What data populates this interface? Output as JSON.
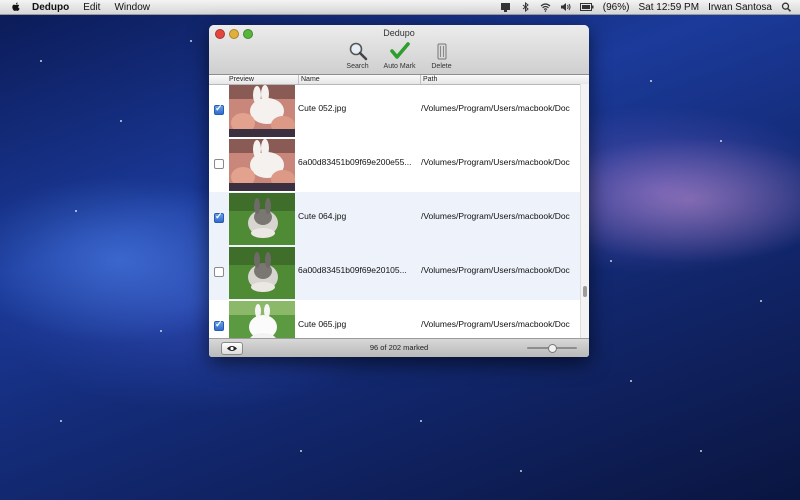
{
  "menubar": {
    "app_name": "Dedupo",
    "menus": [
      "Edit",
      "Window"
    ],
    "battery": "(96%)",
    "clock": "Sat 12:59 PM",
    "user": "Irwan Santosa"
  },
  "window": {
    "title": "Dedupo",
    "toolbar": {
      "search_label": "Search",
      "automark_label": "Auto Mark",
      "delete_label": "Delete"
    },
    "columns": {
      "preview": "Preview",
      "name": "Name",
      "path": "Path"
    },
    "rows": [
      {
        "checked": true,
        "name": "Cute 052.jpg",
        "path": "/Volumes/Program/Users/macbook/Doc",
        "photo": "rabbit-in-hands"
      },
      {
        "checked": false,
        "name": "6a00d83451b09f69e200e55...",
        "path": "/Volumes/Program/Users/macbook/Doc",
        "photo": "rabbit-in-hands"
      },
      {
        "checked": true,
        "name": "Cute 064.jpg",
        "path": "/Volumes/Program/Users/macbook/Doc",
        "photo": "rabbit-on-grass"
      },
      {
        "checked": false,
        "name": "6a00d83451b09f69e20105...",
        "path": "/Volumes/Program/Users/macbook/Doc",
        "photo": "rabbit-on-grass"
      },
      {
        "checked": true,
        "name": "Cute 065.jpg",
        "path": "/Volumes/Program/Users/macbook/Doc",
        "photo": "white-rabbit-grass"
      }
    ],
    "status": "96 of 202 marked"
  },
  "colors": {
    "checkbox_on": "#2f6ccf",
    "row_alt": "#eef3fb"
  }
}
